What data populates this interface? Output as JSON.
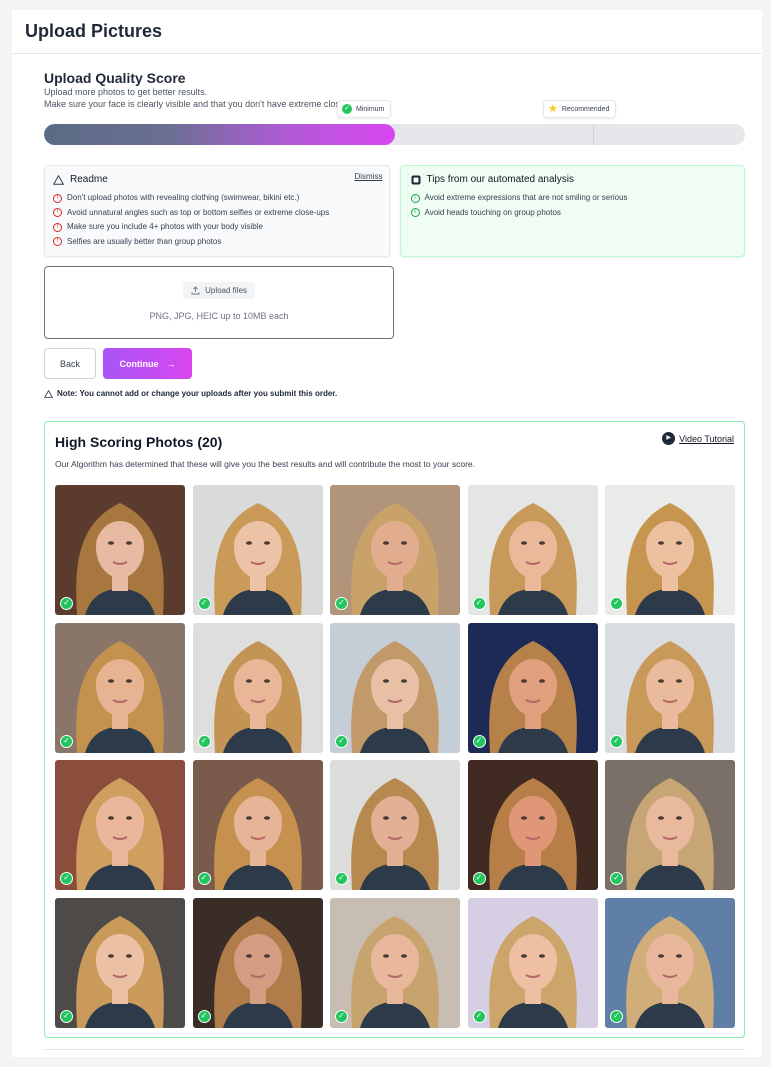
{
  "header": {
    "title": "Upload Pictures"
  },
  "score": {
    "title": "Upload Quality Score",
    "subtitle_1": "Upload more photos to get better results.",
    "subtitle_2": "Make sure your face is clearly visible and that you don't have extreme closeups.",
    "progress_fraction": 0.5,
    "minimum_label": "Minimum",
    "recommended_label": "Recommended"
  },
  "readme": {
    "title": "Readme",
    "dismiss_label": "Dismiss",
    "items": [
      "Don't upload photos with revealing clothing (swimwear, bikini etc.)",
      "Avoid unnatural angles such as top or bottom selfies or extreme close-ups",
      "Make sure you include 4+ photos with your body visible",
      "Selfies are usually better than group photos"
    ]
  },
  "tips": {
    "title": "Tips from our automated analysis",
    "items": [
      "Avoid extreme expressions that are not smiling or serious",
      "Avoid heads touching on group photos"
    ]
  },
  "upload": {
    "button_label": "Upload files",
    "hint": "PNG, JPG, HEIC up to 10MB each"
  },
  "actions": {
    "back_label": "Back",
    "continue_label": "Continue"
  },
  "note": "Note: You cannot add or change your uploads after you submit this order.",
  "high_scoring": {
    "title": "High Scoring Photos (20)",
    "description": "Our Algorithm has determined that these will give you the best results and will contribute the most to your score.",
    "video_label": "Video Tutorial",
    "photos": [
      {
        "bg": "#5a3b2e",
        "hair": "#a8763f",
        "skin": "#e8b9a3"
      },
      {
        "bg": "#d9dbdb",
        "hair": "#c99a58",
        "skin": "#edc3a8"
      },
      {
        "bg": "#b0957a",
        "hair": "#c9a26a",
        "skin": "#e2ad8f"
      },
      {
        "bg": "#e4e6e6",
        "hair": "#c79a5c",
        "skin": "#e9b99a"
      },
      {
        "bg": "#eaeae8",
        "hair": "#c6954f",
        "skin": "#edc0a0"
      },
      {
        "bg": "#8a7668",
        "hair": "#c3924f",
        "skin": "#e6b393"
      },
      {
        "bg": "#dedfdd",
        "hair": "#c49454",
        "skin": "#e9b798"
      },
      {
        "bg": "#c5cdd6",
        "hair": "#c29a6a",
        "skin": "#e8c0a6"
      },
      {
        "bg": "#1e2a56",
        "hair": "#b7824a",
        "skin": "#e0a07d"
      },
      {
        "bg": "#d9dde2",
        "hair": "#c9995a",
        "skin": "#e9bb9c"
      },
      {
        "bg": "#8b4d3c",
        "hair": "#cf9f60",
        "skin": "#eab79a"
      },
      {
        "bg": "#7a5a4a",
        "hair": "#c6914f",
        "skin": "#e6b496"
      },
      {
        "bg": "#dcdcda",
        "hair": "#b8894f",
        "skin": "#e3b095"
      },
      {
        "bg": "#402a22",
        "hair": "#b77e48",
        "skin": "#e09778"
      },
      {
        "bg": "#7a7068",
        "hair": "#c7a574",
        "skin": "#e8b99c"
      },
      {
        "bg": "#4d4a48",
        "hair": "#c99a5a",
        "skin": "#ecc0a3"
      },
      {
        "bg": "#3a2c26",
        "hair": "#b07d4a",
        "skin": "#d49c80"
      },
      {
        "bg": "#c8bdb2",
        "hair": "#c7a36d",
        "skin": "#e8b79c"
      },
      {
        "bg": "#d6cfe3",
        "hair": "#cba56a",
        "skin": "#eebfa3"
      },
      {
        "bg": "#5f7fa6",
        "hair": "#d1ad7a",
        "skin": "#e9b79c"
      }
    ]
  },
  "colors": {
    "accent_start": "#a855f7",
    "accent_end": "#d946ef",
    "success": "#22c55e",
    "warning": "#dc2626"
  }
}
